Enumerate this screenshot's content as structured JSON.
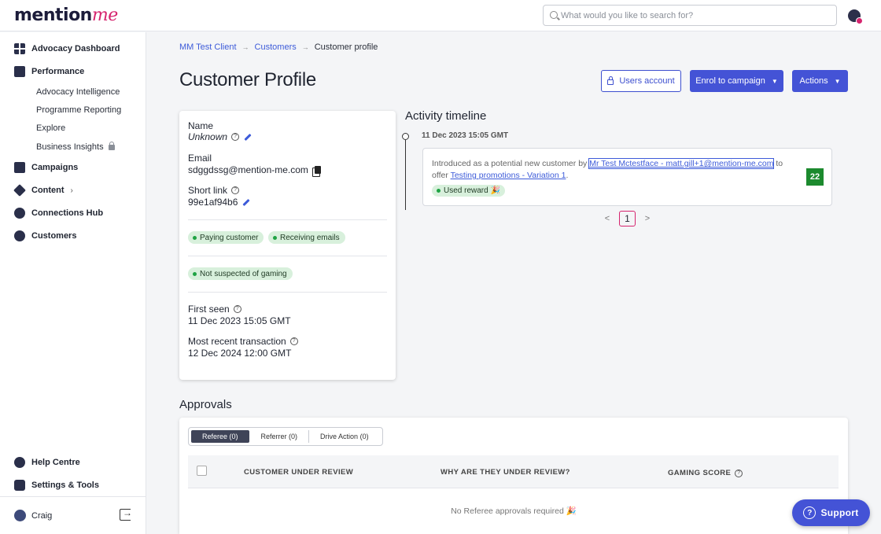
{
  "header": {
    "logo_main": "mention",
    "logo_accent": "me",
    "search_placeholder": "What would you like to search for?"
  },
  "sidebar": {
    "items": [
      {
        "label": "Advocacy Dashboard",
        "icon": "dashboard-icon"
      },
      {
        "label": "Performance",
        "icon": "performance-icon"
      },
      {
        "label": "Campaigns",
        "icon": "campaigns-icon"
      },
      {
        "label": "Content",
        "icon": "content-icon"
      },
      {
        "label": "Connections Hub",
        "icon": "connections-icon"
      },
      {
        "label": "Customers",
        "icon": "customers-icon"
      }
    ],
    "performance_subitems": [
      "Advocacy Intelligence",
      "Programme Reporting",
      "Explore",
      "Business Insights"
    ],
    "help": "Help Centre",
    "settings": "Settings & Tools",
    "user": "Craig"
  },
  "breadcrumb": {
    "client": "MM Test Client",
    "customers": "Customers",
    "current": "Customer profile"
  },
  "page": {
    "title": "Customer Profile",
    "btn_users_account": "Users account",
    "btn_enrol": "Enrol to campaign",
    "btn_actions": "Actions"
  },
  "profile": {
    "name_label": "Name",
    "name_value": "Unknown",
    "email_label": "Email",
    "email_value": "sdggdssg@mention-me.com",
    "shortlink_label": "Short link",
    "shortlink_value": "99e1af94b6",
    "badges": [
      "Paying customer",
      "Receiving emails"
    ],
    "gaming_badge": "Not suspected of gaming",
    "first_seen_label": "First seen",
    "first_seen_value": "11 Dec 2023 15:05 GMT",
    "recent_tx_label": "Most recent transaction",
    "recent_tx_value": "12 Dec 2024 12:00 GMT"
  },
  "activity": {
    "title": "Activity timeline",
    "date": "11 Dec 2023 15:05 GMT",
    "text_prefix": "Introduced as a potential new customer by ",
    "referrer_link": "Mr Test Mctestface - matt.gill+1@mention-me.com",
    "text_middle": " to offer ",
    "offer_link": "Testing promotions - Variation 1",
    "text_suffix": ".",
    "reward_badge": "Used reward 🎉",
    "score": "22",
    "page": "1"
  },
  "approvals": {
    "title": "Approvals",
    "tabs": [
      "Referee (0)",
      "Referrer (0)",
      "Drive Action (0)"
    ],
    "columns": [
      "CUSTOMER UNDER REVIEW",
      "WHY ARE THEY UNDER REVIEW?",
      "GAMING SCORE"
    ],
    "empty": "No Referee approvals required 🎉"
  },
  "support": {
    "label": "Support"
  }
}
